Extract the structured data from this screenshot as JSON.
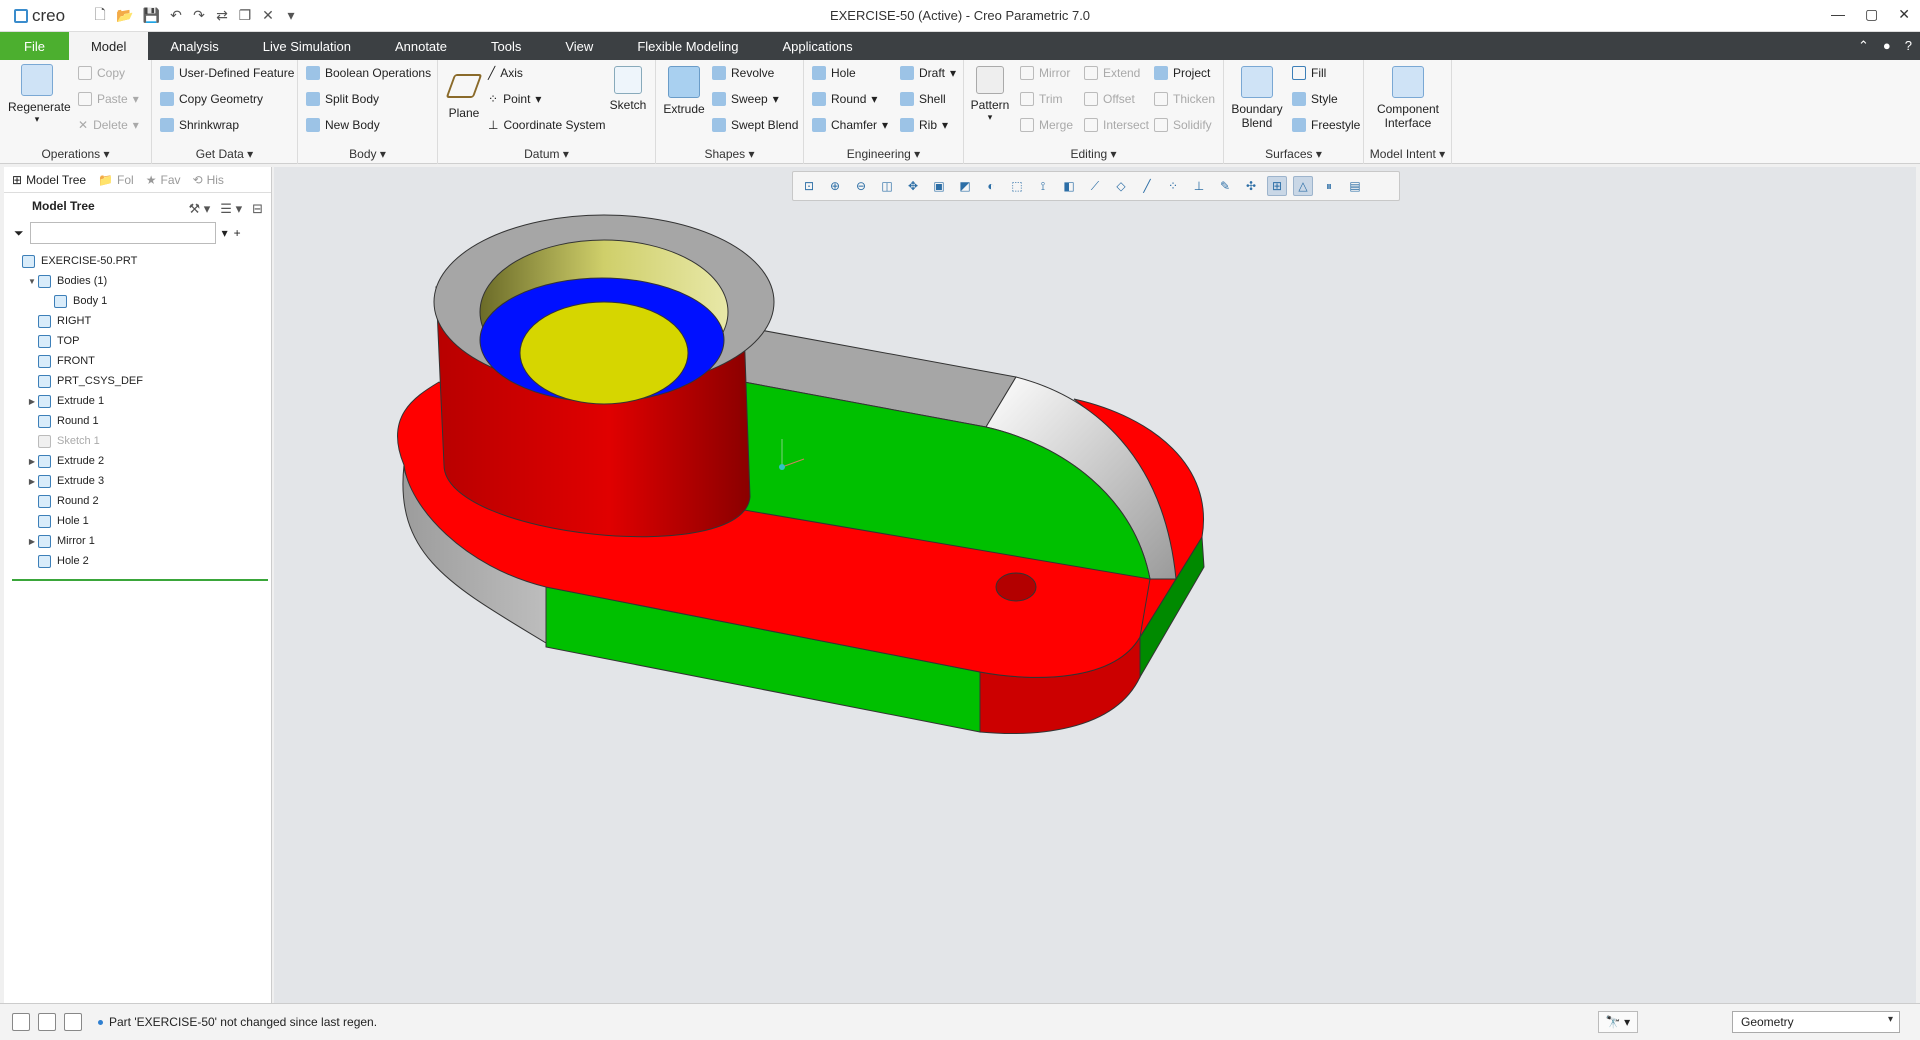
{
  "app": {
    "logo_text": "creo",
    "window_title": "EXERCISE-50 (Active) - Creo Parametric 7.0"
  },
  "quick_access": [
    "new-icon",
    "open-icon",
    "save-icon",
    "undo-icon",
    "redo-icon",
    "regenerate-icon",
    "windows-icon",
    "close-window-icon",
    "customize-icon"
  ],
  "tabs": {
    "file": "File",
    "model": "Model",
    "analysis": "Analysis",
    "live_simulation": "Live Simulation",
    "annotate": "Annotate",
    "tools": "Tools",
    "view": "View",
    "flexible_modeling": "Flexible Modeling",
    "applications": "Applications"
  },
  "ribbon": {
    "operations": {
      "label": "Operations",
      "regenerate": "Regenerate",
      "copy": "Copy",
      "paste": "Paste",
      "delete": "Delete"
    },
    "get_data": {
      "label": "Get Data",
      "udf": "User-Defined Feature",
      "copy_geometry": "Copy Geometry",
      "shrinkwrap": "Shrinkwrap"
    },
    "body": {
      "label": "Body",
      "boolean": "Boolean Operations",
      "split": "Split Body",
      "new": "New Body"
    },
    "datum": {
      "label": "Datum",
      "plane": "Plane",
      "axis": "Axis",
      "point": "Point",
      "csys": "Coordinate System",
      "sketch": "Sketch"
    },
    "shapes": {
      "label": "Shapes",
      "extrude": "Extrude",
      "revolve": "Revolve",
      "sweep": "Sweep",
      "swept_blend": "Swept Blend"
    },
    "engineering": {
      "label": "Engineering",
      "hole": "Hole",
      "round": "Round",
      "chamfer": "Chamfer",
      "draft": "Draft",
      "shell": "Shell",
      "rib": "Rib"
    },
    "editing": {
      "label": "Editing",
      "pattern": "Pattern",
      "mirror": "Mirror",
      "trim": "Trim",
      "merge": "Merge",
      "extend": "Extend",
      "offset": "Offset",
      "intersect": "Intersect",
      "project": "Project",
      "thicken": "Thicken",
      "solidify": "Solidify"
    },
    "surfaces": {
      "label": "Surfaces",
      "boundary_blend_1": "Boundary",
      "boundary_blend_2": "Blend",
      "fill": "Fill",
      "style": "Style",
      "freestyle": "Freestyle"
    },
    "model_intent": {
      "label": "Model Intent",
      "component_1": "Component",
      "component_2": "Interface"
    }
  },
  "panel": {
    "tabs": [
      "Model Tree",
      "Fol",
      "Fav",
      "His"
    ],
    "tree_title": "Model Tree",
    "filter_placeholder": "",
    "tree": [
      {
        "label": "EXERCISE-50.PRT",
        "indent": 0,
        "toggle": "",
        "dim": false
      },
      {
        "label": "Bodies (1)",
        "indent": 1,
        "toggle": "▼",
        "dim": false
      },
      {
        "label": "Body 1",
        "indent": 2,
        "toggle": "",
        "dim": false
      },
      {
        "label": "RIGHT",
        "indent": 1,
        "toggle": "",
        "dim": false
      },
      {
        "label": "TOP",
        "indent": 1,
        "toggle": "",
        "dim": false
      },
      {
        "label": "FRONT",
        "indent": 1,
        "toggle": "",
        "dim": false
      },
      {
        "label": "PRT_CSYS_DEF",
        "indent": 1,
        "toggle": "",
        "dim": false
      },
      {
        "label": "Extrude 1",
        "indent": 1,
        "toggle": "▶",
        "dim": false
      },
      {
        "label": "Round 1",
        "indent": 1,
        "toggle": "",
        "dim": false
      },
      {
        "label": "Sketch 1",
        "indent": 1,
        "toggle": "",
        "dim": true
      },
      {
        "label": "Extrude 2",
        "indent": 1,
        "toggle": "▶",
        "dim": false
      },
      {
        "label": "Extrude 3",
        "indent": 1,
        "toggle": "▶",
        "dim": false
      },
      {
        "label": "Round 2",
        "indent": 1,
        "toggle": "",
        "dim": false
      },
      {
        "label": "Hole 1",
        "indent": 1,
        "toggle": "",
        "dim": false
      },
      {
        "label": "Mirror 1",
        "indent": 1,
        "toggle": "▶",
        "dim": false
      },
      {
        "label": "Hole 2",
        "indent": 1,
        "toggle": "",
        "dim": false
      }
    ]
  },
  "view_toolbar": [
    "refit-icon",
    "zoom-in-icon",
    "zoom-out-icon",
    "repaint-icon",
    "pan-icon",
    "saved-orientations-icon",
    "named-views-icon",
    "display-style-icon",
    "perspective-icon",
    "section-icon",
    "view-manager-icon",
    "datum-display-icon",
    "plane-display-icon",
    "axis-display-icon",
    "point-display-icon",
    "csys-display-icon",
    "annotation-display-icon",
    "spin-center-icon",
    "model-tree-display-icon",
    "glass-icon",
    "pause-icon",
    "more-icon"
  ],
  "colors": {
    "red_face": "#ff0000",
    "green_face": "#00c000",
    "blue_face": "#0010ff",
    "yellow_face": "#d6d600",
    "gray_face": "#a6a6a6"
  },
  "status": {
    "message": "Part 'EXERCISE-50' not changed since last regen.",
    "selection_filter": "Geometry"
  }
}
